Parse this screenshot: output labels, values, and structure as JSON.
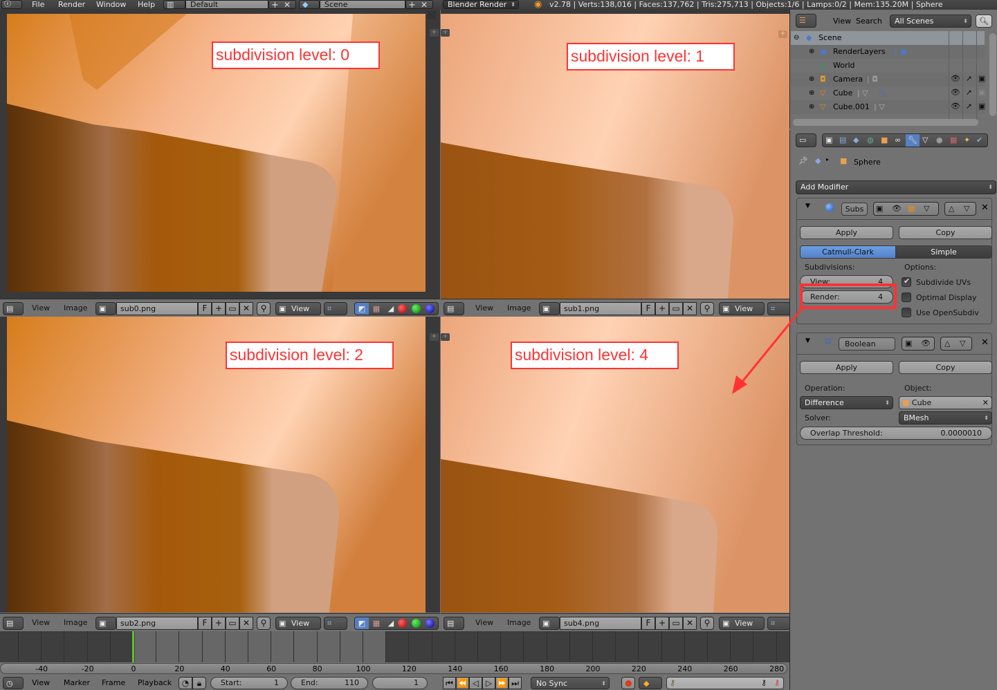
{
  "topbar": {
    "menus": [
      "File",
      "Render",
      "Window",
      "Help"
    ],
    "screen_layout": "Default",
    "scene": "Scene",
    "render_engine": "Blender Render",
    "stats": "v2.78 | Verts:138,016 | Faces:137,762 | Tris:275,713 | Objects:1/6 | Lamps:0/2 | Mem:135.20M | Sphere"
  },
  "viewports": [
    {
      "label": "subdivision level: 0",
      "file": "sub0.png",
      "view_menu": "View",
      "image_menu": "Image",
      "f_label": "F",
      "display": "View"
    },
    {
      "label": "subdivision level: 1",
      "file": "sub1.png",
      "view_menu": "View",
      "image_menu": "Image",
      "f_label": "F",
      "display": "View"
    },
    {
      "label": "subdivision level: 2",
      "file": "sub2.png",
      "view_menu": "View",
      "image_menu": "Image",
      "f_label": "F",
      "display": "View"
    },
    {
      "label": "subdivision level: 4",
      "file": "sub4.png",
      "view_menu": "View",
      "image_menu": "Image",
      "f_label": "F",
      "display": "View"
    }
  ],
  "timeline": {
    "ticks": [
      "-40",
      "-20",
      "0",
      "20",
      "40",
      "60",
      "80",
      "100",
      "120",
      "140",
      "160",
      "180",
      "200",
      "220",
      "240",
      "260",
      "280"
    ],
    "current_frame_marker": 0,
    "menus": [
      "View",
      "Marker",
      "Frame",
      "Playback"
    ],
    "start_label": "Start:",
    "start": "1",
    "end_label": "End:",
    "end": "110",
    "current": "1",
    "sync": "No Sync"
  },
  "outliner": {
    "menus": [
      "View",
      "Search"
    ],
    "filter": "All Scenes",
    "items": [
      {
        "name": "Scene",
        "depth": 0
      },
      {
        "name": "RenderLayers",
        "depth": 1
      },
      {
        "name": "World",
        "depth": 1
      },
      {
        "name": "Camera",
        "depth": 1
      },
      {
        "name": "Cube",
        "depth": 1
      },
      {
        "name": "Cube.001",
        "depth": 1
      }
    ]
  },
  "properties": {
    "context_object": "Sphere",
    "add_modifier": "Add Modifier",
    "subsurf": {
      "name": "Subs",
      "apply": "Apply",
      "copy": "Copy",
      "mode_options": [
        "Catmull-Clark",
        "Simple"
      ],
      "mode_selected": "Catmull-Clark",
      "subdivisions_label": "Subdivisions:",
      "view_label": "View:",
      "view_value": "4",
      "render_label": "Render:",
      "render_value": "4",
      "options_label": "Options:",
      "options": [
        {
          "label": "Subdivide UVs",
          "checked": true
        },
        {
          "label": "Optimal Display",
          "checked": false
        },
        {
          "label": "Use OpenSubdiv",
          "checked": false
        }
      ]
    },
    "boolean": {
      "name": "Boolean",
      "apply": "Apply",
      "copy": "Copy",
      "operation_label": "Operation:",
      "operation": "Difference",
      "object_label": "Object:",
      "object": "Cube",
      "solver_label": "Solver:",
      "solver": "BMesh",
      "overlap_label": "Overlap Threshold:",
      "overlap_value": "0.0000010"
    }
  },
  "annotation": {
    "color": "#ff3333"
  }
}
